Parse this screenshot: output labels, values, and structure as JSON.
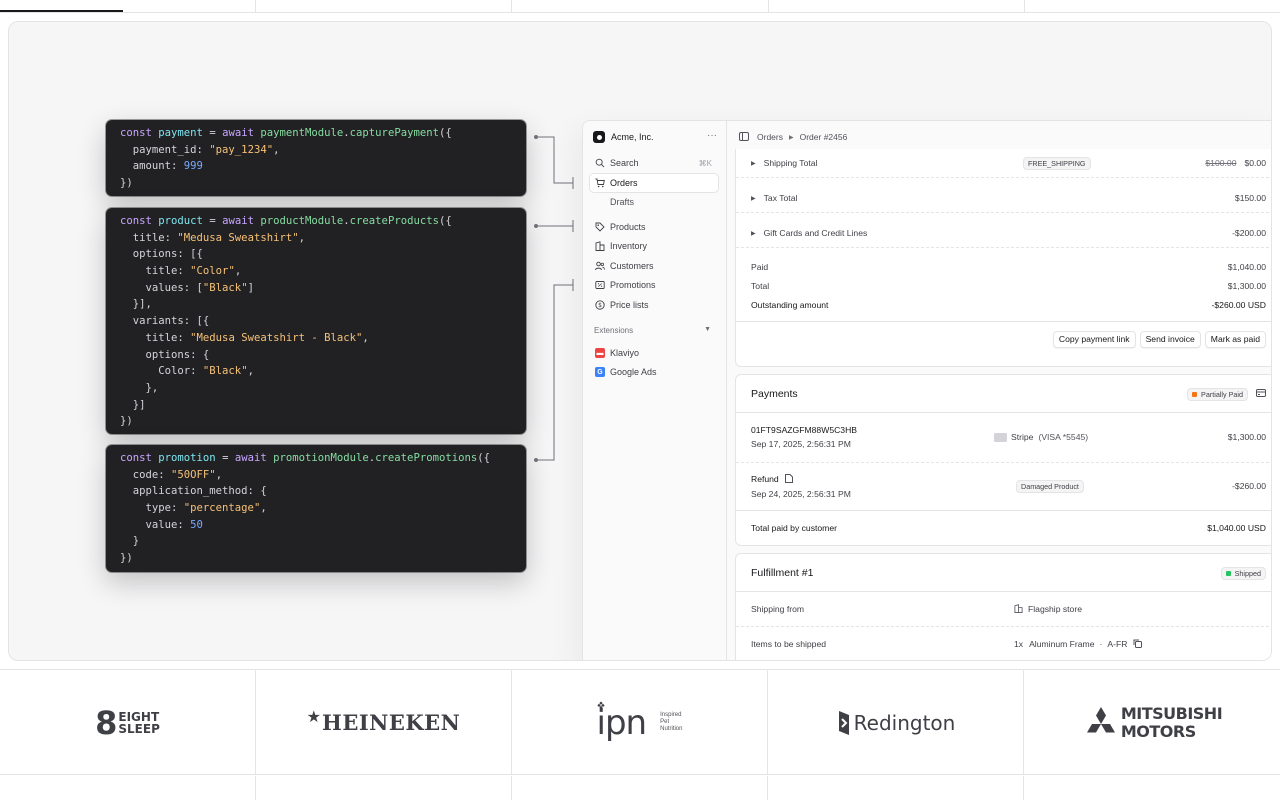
{
  "code_blocks": [
    {
      "lines": [
        [
          [
            "kw",
            "const "
          ],
          [
            "var",
            "payment"
          ],
          [
            "plain",
            " = "
          ],
          [
            "kw",
            "await "
          ],
          [
            "fn",
            "paymentModule"
          ],
          [
            "plain",
            "."
          ],
          [
            "fn",
            "capturePayment"
          ],
          [
            "plain",
            "({"
          ]
        ],
        [
          [
            "plain",
            "  payment_id: "
          ],
          [
            "str",
            "\"pay_1234\""
          ],
          [
            "plain",
            ","
          ]
        ],
        [
          [
            "plain",
            "  amount: "
          ],
          [
            "num",
            "999"
          ]
        ],
        [
          [
            "plain",
            "})"
          ]
        ]
      ]
    },
    {
      "lines": [
        [
          [
            "kw",
            "const "
          ],
          [
            "var",
            "product"
          ],
          [
            "plain",
            " = "
          ],
          [
            "kw",
            "await "
          ],
          [
            "fn",
            "productModule"
          ],
          [
            "plain",
            "."
          ],
          [
            "fn",
            "createProducts"
          ],
          [
            "plain",
            "({"
          ]
        ],
        [
          [
            "plain",
            "  title: "
          ],
          [
            "str",
            "\"Medusa Sweatshirt\""
          ],
          [
            "plain",
            ","
          ]
        ],
        [
          [
            "plain",
            "  options: [{"
          ]
        ],
        [
          [
            "plain",
            "    title: "
          ],
          [
            "str",
            "\"Color\""
          ],
          [
            "plain",
            ","
          ]
        ],
        [
          [
            "plain",
            "    values: ["
          ],
          [
            "str",
            "\"Black\""
          ],
          [
            "plain",
            "]"
          ]
        ],
        [
          [
            "plain",
            "  }],"
          ]
        ],
        [
          [
            "plain",
            "  variants: [{"
          ]
        ],
        [
          [
            "plain",
            "    title: "
          ],
          [
            "str",
            "\"Medusa Sweatshirt - Black\""
          ],
          [
            "plain",
            ","
          ]
        ],
        [
          [
            "plain",
            "    options: {"
          ]
        ],
        [
          [
            "plain",
            "      Color: "
          ],
          [
            "str",
            "\"Black\""
          ],
          [
            "plain",
            ","
          ]
        ],
        [
          [
            "plain",
            "    },"
          ]
        ],
        [
          [
            "plain",
            "  }]"
          ]
        ],
        [
          [
            "plain",
            "})"
          ]
        ]
      ]
    },
    {
      "lines": [
        [
          [
            "kw",
            "const "
          ],
          [
            "var",
            "promotion"
          ],
          [
            "plain",
            " = "
          ],
          [
            "kw",
            "await "
          ],
          [
            "fn",
            "promotionModule"
          ],
          [
            "plain",
            "."
          ],
          [
            "fn",
            "createPromotions"
          ],
          [
            "plain",
            "({"
          ]
        ],
        [
          [
            "plain",
            "  code: "
          ],
          [
            "str",
            "\"50OFF\""
          ],
          [
            "plain",
            ","
          ]
        ],
        [
          [
            "plain",
            "  application_method: {"
          ]
        ],
        [
          [
            "plain",
            "    type: "
          ],
          [
            "str",
            "\"percentage\""
          ],
          [
            "plain",
            ","
          ]
        ],
        [
          [
            "plain",
            "    value: "
          ],
          [
            "num",
            "50"
          ]
        ],
        [
          [
            "plain",
            "  }"
          ]
        ],
        [
          [
            "plain",
            "})"
          ]
        ]
      ]
    }
  ],
  "sidebar": {
    "store_name": "Acme, Inc.",
    "more_icon": "ellipsis-icon",
    "search_label": "Search",
    "search_shortcut": "⌘K",
    "items": [
      {
        "label": "Orders",
        "icon": "cart-icon"
      },
      {
        "label": "Drafts",
        "icon": ""
      },
      {
        "label": "Products",
        "icon": "tag-icon"
      },
      {
        "label": "Inventory",
        "icon": "building-icon"
      },
      {
        "label": "Customers",
        "icon": "users-icon"
      },
      {
        "label": "Promotions",
        "icon": "receipt-icon"
      },
      {
        "label": "Price lists",
        "icon": "coin-icon"
      }
    ],
    "extensions_label": "Extensions",
    "extensions": [
      {
        "label": "Klaviyo",
        "color": "#ef4444"
      },
      {
        "label": "Google Ads",
        "color": "#3b82f6"
      }
    ]
  },
  "breadcrumb": {
    "first": "Orders",
    "second": "Order #2456"
  },
  "summary": {
    "shipping_label": "Shipping Total",
    "shipping_tag": "FREE_SHIPPING",
    "shipping_old": "$100.00",
    "shipping_value": "$0.00",
    "tax_label": "Tax Total",
    "tax_value": "$150.00",
    "gift_label": "Gift Cards and Credit Lines",
    "gift_value": "-$200.00",
    "paid_label": "Paid",
    "paid_value": "$1,040.00",
    "total_label": "Total",
    "total_value": "$1,300.00",
    "outstanding_label": "Outstanding amount",
    "outstanding_value": "-$260.00 USD",
    "copy_link": "Copy payment link",
    "send_invoice": "Send invoice",
    "mark_paid": "Mark as paid"
  },
  "payments": {
    "title": "Payments",
    "status": "Partially Paid",
    "status_color": "#f97316",
    "payment_id": "01FT9SAZGFM88W5C3HB",
    "payment_date": "Sep 17, 2025, 2:56:31 PM",
    "provider": "Stripe",
    "card": "(VISA *5545)",
    "payment_amount": "$1,300.00",
    "refund_label": "Refund",
    "refund_date": "Sep 24, 2025, 2:56:31 PM",
    "refund_reason": "Damaged Product",
    "refund_amount": "-$260.00",
    "total_label": "Total paid by customer",
    "total_value": "$1,040.00 USD"
  },
  "fulfillment": {
    "title": "Fulfillment #1",
    "status": "Shipped",
    "status_color": "#22c55e",
    "from_label": "Shipping from",
    "from_value": "Flagship store",
    "items_label": "Items to be shipped",
    "item_qty": "1x",
    "item_name": "Aluminum Frame",
    "item_sep": "·",
    "item_sku": "A-FR"
  },
  "logos": {
    "eight_sleep_number": "8",
    "eight_sleep_top": "EIGHT",
    "eight_sleep_bottom": "SLEEP",
    "heineken": "HEINEKEN",
    "ipn": "ipn",
    "ipn_tag_1": "Inspired",
    "ipn_tag_2": "Pet",
    "ipn_tag_3": "Nutrition",
    "redington": "Redington",
    "mitsubishi_top": "MITSUBISHI",
    "mitsubishi_bottom": "MOTORS"
  }
}
